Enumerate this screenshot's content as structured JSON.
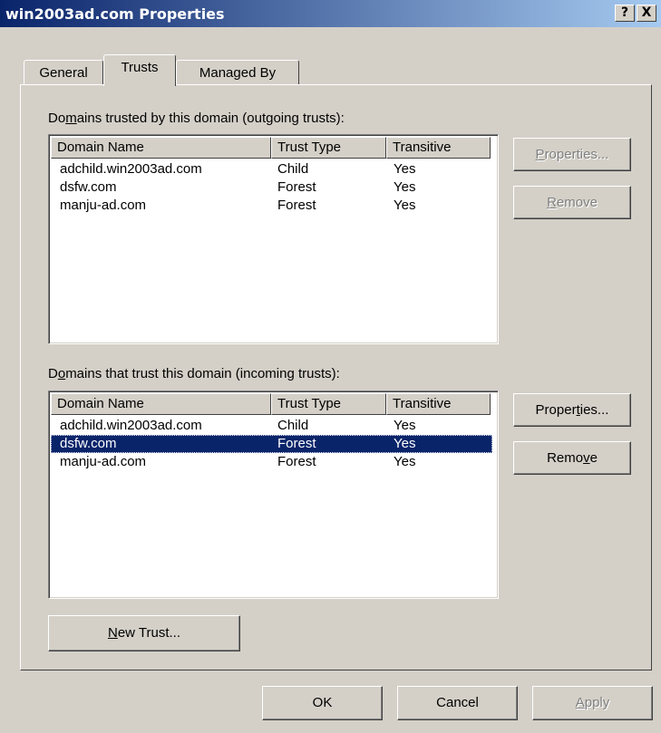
{
  "window": {
    "title": "win2003ad.com Properties",
    "help_btn": "?",
    "close_btn": "X"
  },
  "tabs": [
    {
      "label": "General",
      "selected": false
    },
    {
      "label": "Trusts",
      "selected": true
    },
    {
      "label": "Managed By",
      "selected": false
    }
  ],
  "outgoing": {
    "label_pre": "Do",
    "label_key": "m",
    "label_post": "ains trusted by this domain (outgoing trusts):",
    "columns": [
      "Domain Name",
      "Trust Type",
      "Transitive"
    ],
    "rows": [
      {
        "name": "adchild.win2003ad.com",
        "type": "Child",
        "transitive": "Yes"
      },
      {
        "name": "dsfw.com",
        "type": "Forest",
        "transitive": "Yes"
      },
      {
        "name": "manju-ad.com",
        "type": "Forest",
        "transitive": "Yes"
      }
    ],
    "properties": {
      "pre": "",
      "key": "P",
      "post": "roperties..."
    },
    "remove": {
      "pre": "",
      "key": "R",
      "post": "emove"
    },
    "buttons_enabled": false
  },
  "incoming": {
    "label_pre": "D",
    "label_key": "o",
    "label_post": "mains that trust this domain (incoming trusts):",
    "columns": [
      "Domain Name",
      "Trust Type",
      "Transitive"
    ],
    "rows": [
      {
        "name": "adchild.win2003ad.com",
        "type": "Child",
        "transitive": "Yes",
        "selected": false
      },
      {
        "name": "dsfw.com",
        "type": "Forest",
        "transitive": "Yes",
        "selected": true
      },
      {
        "name": "manju-ad.com",
        "type": "Forest",
        "transitive": "Yes",
        "selected": false
      }
    ],
    "properties": {
      "pre": "Proper",
      "key": "t",
      "post": "ies..."
    },
    "remove": {
      "pre": "Remo",
      "key": "v",
      "post": "e"
    },
    "buttons_enabled": true
  },
  "new_trust": {
    "pre": "",
    "key": "N",
    "post": "ew Trust..."
  },
  "footer": {
    "ok": "OK",
    "cancel": "Cancel",
    "apply": {
      "pre": "",
      "key": "A",
      "post": "pply"
    },
    "apply_enabled": false
  }
}
